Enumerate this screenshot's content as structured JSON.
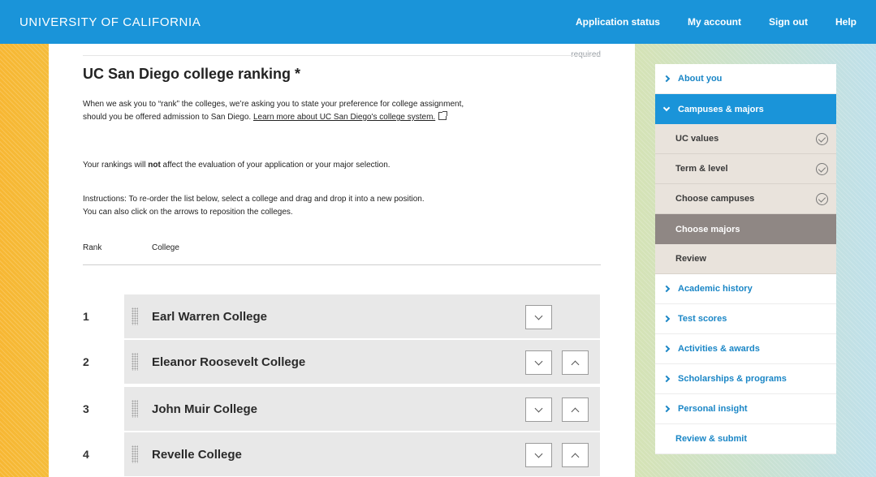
{
  "header": {
    "brand": "UNIVERSITY OF CALIFORNIA",
    "nav": [
      "Application status",
      "My account",
      "Sign out",
      "Help"
    ],
    "background_color": "#1a94d9"
  },
  "main": {
    "required_note": "required",
    "title": "UC San Diego college ranking *",
    "intro_text": "When we ask you to “rank” the colleges, we’re asking you to state your preference for college assignment, should you be offered admission to San Diego.",
    "learn_more_link": "Learn more about UC San Diego's college system.",
    "rankings_note_before": "Your rankings will ",
    "rankings_note_bold": "not",
    "rankings_note_after": " affect the evaluation of your application or your major selection.",
    "instructions_line1": "Instructions: To re-order the list below, select a college and drag and drop it into a new position.",
    "instructions_line2": "You can also click on the arrows to reposition the colleges.",
    "columns": {
      "rank": "Rank",
      "college": "College"
    },
    "rankings": [
      {
        "rank": "1",
        "college": "Earl Warren College"
      },
      {
        "rank": "2",
        "college": "Eleanor Roosevelt College"
      },
      {
        "rank": "3",
        "college": "John Muir College"
      },
      {
        "rank": "4",
        "college": "Revelle College"
      }
    ]
  },
  "sidebar": {
    "items": [
      {
        "label": "About you",
        "state": "collapsed"
      },
      {
        "label": "Campuses & majors",
        "state": "expanded"
      },
      {
        "label": "Academic history",
        "state": "collapsed"
      },
      {
        "label": "Test scores",
        "state": "collapsed"
      },
      {
        "label": "Activities & awards",
        "state": "collapsed"
      },
      {
        "label": "Scholarships & programs",
        "state": "collapsed"
      },
      {
        "label": "Personal insight",
        "state": "collapsed"
      },
      {
        "label": "Review & submit",
        "state": "plain"
      }
    ],
    "subitems": [
      {
        "label": "UC values",
        "complete": true
      },
      {
        "label": "Term & level",
        "complete": true
      },
      {
        "label": "Choose campuses",
        "complete": true
      },
      {
        "label": "Choose majors",
        "current": true
      },
      {
        "label": "Review",
        "complete": false
      }
    ],
    "active_color": "#1a94d9",
    "current_color": "#8f8784"
  }
}
